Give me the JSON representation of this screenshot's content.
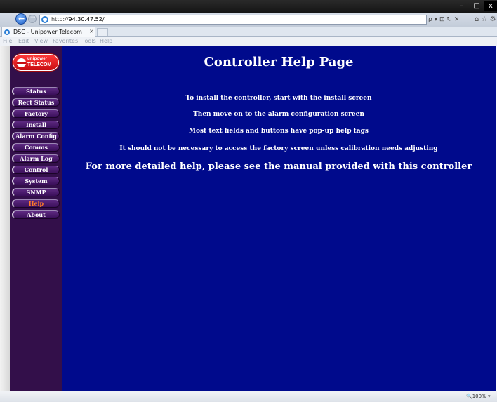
{
  "browser": {
    "url_prefix": "http://",
    "url_host": "94.30.47.52/",
    "tab_title": "DSC - Unipower Telecom",
    "tab_close": "×",
    "menu": [
      "File",
      "Edit",
      "View",
      "Favorites",
      "Tools",
      "Help"
    ],
    "toolbar_glyphs": "ρ ▾ ⊡ ↻ ✕",
    "right_glyphs": "⌂ ☆ ⚙",
    "window_controls": {
      "minimize": "–",
      "maximize": "□",
      "close": "x"
    },
    "zoom": "🔍100%  ▾"
  },
  "logo": {
    "line1": "unipower",
    "line2": "TELECOM"
  },
  "nav": [
    {
      "label": "Status",
      "active": false
    },
    {
      "label": "Rect Status",
      "active": false
    },
    {
      "label": "Factory",
      "active": false
    },
    {
      "label": "Install",
      "active": false
    },
    {
      "label": "Alarm Config",
      "active": false
    },
    {
      "label": "Comms",
      "active": false
    },
    {
      "label": "Alarm Log",
      "active": false
    },
    {
      "label": "Control",
      "active": false
    },
    {
      "label": "System",
      "active": false
    },
    {
      "label": "SNMP",
      "active": false
    },
    {
      "label": "Help",
      "active": true
    },
    {
      "label": "About",
      "active": false
    }
  ],
  "main": {
    "title": "Controller Help Page",
    "lines": [
      "To install the controller, start with the install screen",
      "Then move on to the alarm configuration screen",
      "Most text fields and buttons have pop-up help tags",
      "It should not be necessary to access the factory screen unless calibration needs adjusting",
      "For more detailed help, please see the manual provided with this controller"
    ]
  },
  "colors": {
    "page_bg": "#000a8c",
    "sidebar_bg": "#330f4a",
    "active_nav": "#ff7a2a"
  }
}
